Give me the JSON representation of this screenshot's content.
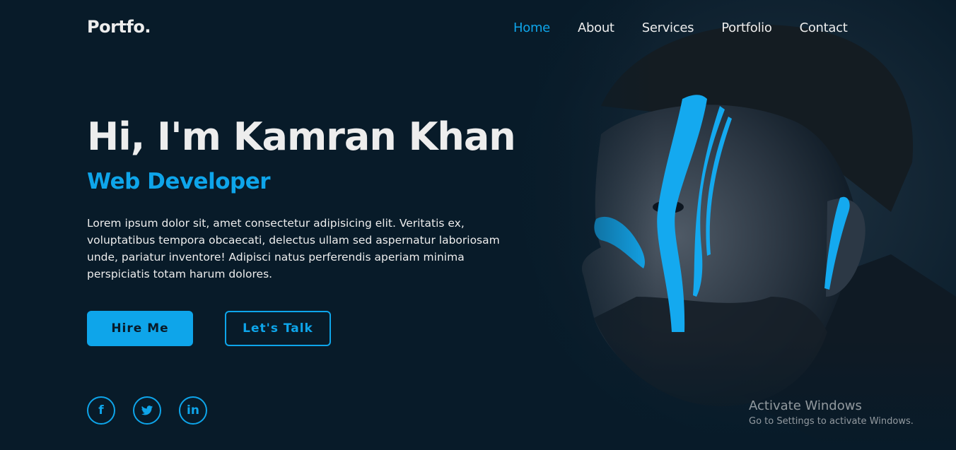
{
  "header": {
    "logo": "Portfo.",
    "nav": [
      "Home",
      "About",
      "Services",
      "Portfolio",
      "Contact"
    ],
    "active_nav": "Home"
  },
  "hero": {
    "title": "Hi, I'm Kamran Khan",
    "subtitle": "Web Developer",
    "description": "Lorem ipsum dolor sit, amet consectetur adipisicing elit. Veritatis ex, voluptatibus tempora obcaecati, delectus ullam sed aspernatur laboriosam unde, pariatur inventore! Adipisci natus perferendis aperiam minima perspiciatis totam harum dolores.",
    "primary_button": "Hire Me",
    "secondary_button": "Let's Talk",
    "socials": [
      {
        "icon": "facebook-icon",
        "glyph": "f"
      },
      {
        "icon": "twitter-icon",
        "glyph": ""
      },
      {
        "icon": "linkedin-icon",
        "glyph": "in"
      }
    ]
  },
  "watermark": {
    "title": "Activate Windows",
    "subtitle": "Go to Settings to activate Windows."
  },
  "colors": {
    "background": "#081b29",
    "accent": "#0ea5ea",
    "text": "#ededed"
  }
}
